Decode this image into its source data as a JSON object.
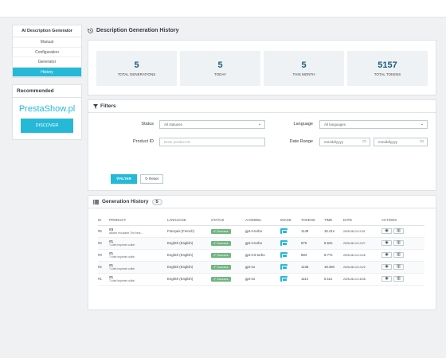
{
  "sidebar": {
    "title": "AI Description Generator",
    "items": [
      {
        "label": "Manual"
      },
      {
        "label": "Configuration"
      },
      {
        "label": "Generator"
      },
      {
        "label": "History"
      }
    ],
    "recommended": {
      "title": "Recommended",
      "brand": "PrestaShow.pl",
      "button": "DISCOVER"
    }
  },
  "page": {
    "title": "Description Generation History"
  },
  "stats": [
    {
      "value": "5",
      "label": "TOTAL GENERATIONS"
    },
    {
      "value": "5",
      "label": "TODAY"
    },
    {
      "value": "5",
      "label": "THIS MONTH"
    },
    {
      "value": "5157",
      "label": "TOTAL TOKENS"
    }
  ],
  "filters": {
    "title": "Filters",
    "status_label": "Status",
    "status_value": "All statuses",
    "language_label": "Language",
    "language_value": "All languages",
    "product_label": "Product ID",
    "product_placeholder": "Enter product ID",
    "date_label": "Date Range",
    "date_from_placeholder": "mm/dd/yyyy",
    "date_to_placeholder": "mm/dd/yyyy",
    "filter_button": "FILTER",
    "reset_button": "Reset"
  },
  "history": {
    "title": "Generation History",
    "count": "5",
    "columns": [
      "ID",
      "PRODUCT",
      "LANGUAGE",
      "STATUS",
      "AI MODEL",
      "IMAGE",
      "TOKENS",
      "TIME",
      "DATE",
      "ACTIONS"
    ],
    "rows": [
      {
        "id": "#5",
        "product_num": "#3",
        "product_name": "Affiche encadrée The best...",
        "language": "Français (French)",
        "status": "Success",
        "model": "gpt-4-turbo",
        "tokens": "1149",
        "time": "15.21s",
        "date": "2025-08-13 13:31"
      },
      {
        "id": "#4",
        "product_num": "#1",
        "product_name": "T-shirt imprimé colibri",
        "language": "English (English)",
        "status": "Success",
        "model": "gpt-4-turbo",
        "tokens": "876",
        "time": "5.52s",
        "date": "2025-08-13 13:27"
      },
      {
        "id": "#3",
        "product_num": "#1",
        "product_name": "T-shirt imprimé colibri",
        "language": "English (English)",
        "status": "Success",
        "model": "gpt-3.5-turbo",
        "tokens": "883",
        "time": "8.77s",
        "date": "2025-08-13 13:26"
      },
      {
        "id": "#2",
        "product_num": "#1",
        "product_name": "T-shirt imprimé colibri",
        "language": "English (English)",
        "status": "Success",
        "model": "gpt-4o",
        "tokens": "1135",
        "time": "19.38s",
        "date": "2025-08-13 13:22"
      },
      {
        "id": "#1",
        "product_num": "#1",
        "product_name": "T-shirt imprimé colibri",
        "language": "English (English)",
        "status": "Success",
        "model": "gpt-4o",
        "tokens": "1114",
        "time": "5.11s",
        "date": "2025-08-13 18:08"
      }
    ]
  }
}
